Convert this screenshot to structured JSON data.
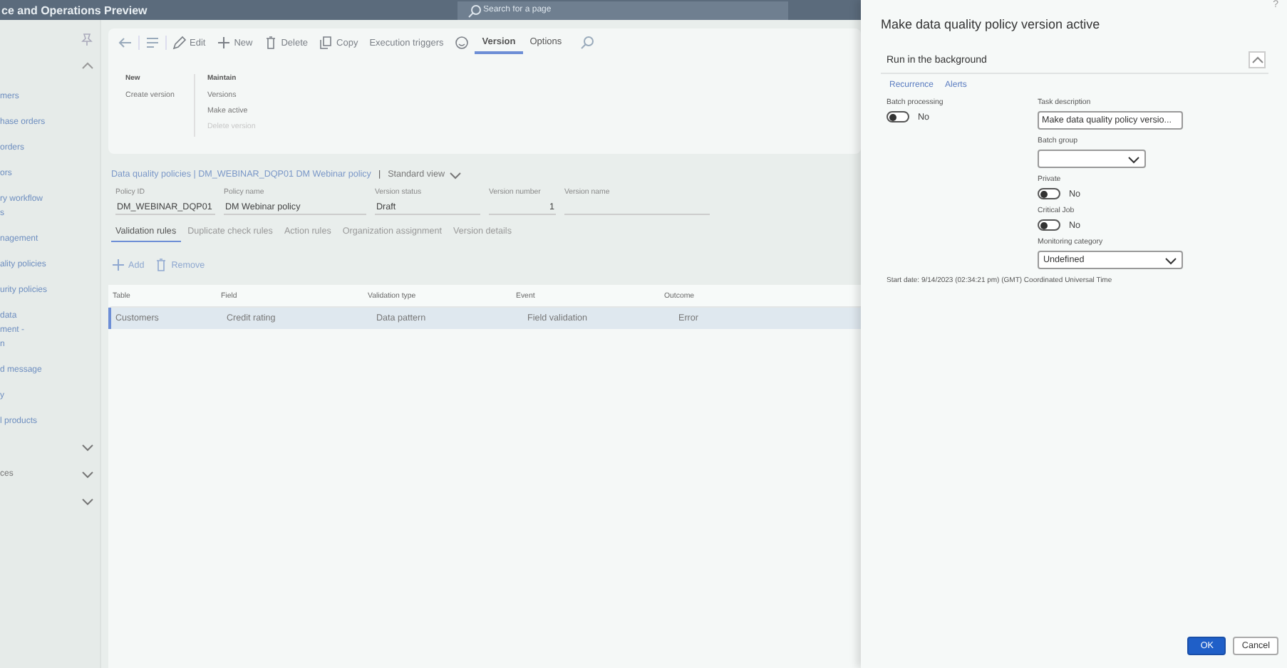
{
  "app_bar": {
    "title": "ce and Operations Preview",
    "search": {
      "placeholder": "Search for a page"
    }
  },
  "sidebar": {
    "items": [
      {
        "lines": [
          "mers"
        ]
      },
      {
        "lines": [
          "hase orders"
        ]
      },
      {
        "lines": [
          "orders"
        ]
      },
      {
        "lines": [
          "ors"
        ]
      },
      {
        "lines": [
          "ry workflow",
          "s"
        ]
      },
      {
        "lines": [
          "nagement"
        ]
      },
      {
        "lines": [
          "ality policies"
        ]
      },
      {
        "lines": [
          "urity policies"
        ]
      },
      {
        "lines": [
          "data",
          "ment -",
          "n"
        ]
      },
      {
        "lines": [
          "d message"
        ]
      },
      {
        "lines": [
          "y"
        ]
      },
      {
        "lines": [
          "l products"
        ]
      }
    ],
    "groups": [
      {
        "expanded": false
      },
      {
        "label": "ces",
        "expanded": false
      },
      {
        "expanded": false
      }
    ]
  },
  "action_pane": {
    "buttons": [
      {
        "kind": "back"
      },
      {
        "kind": "menu"
      },
      {
        "kind": "edit",
        "label": "Edit"
      },
      {
        "kind": "new",
        "label": "New"
      },
      {
        "kind": "delete",
        "label": "Delete"
      },
      {
        "kind": "copy",
        "label": "Copy"
      },
      {
        "kind": "text",
        "label": "Execution triggers"
      },
      {
        "kind": "smiley"
      }
    ],
    "tabs": [
      {
        "label": "Version",
        "selected": true
      },
      {
        "label": "Options",
        "selected": false
      }
    ],
    "groups": [
      {
        "title": "New",
        "items": [
          {
            "label": "Create version",
            "disabled": false
          }
        ]
      },
      {
        "title": "Maintain",
        "items": [
          {
            "label": "Versions",
            "disabled": false
          },
          {
            "label": "Make active",
            "disabled": false
          },
          {
            "label": "Delete version",
            "disabled": true
          }
        ]
      }
    ]
  },
  "breadcrumb": {
    "path": "Data quality policies | DM_WEBINAR_DQP01 DM Webinar policy",
    "separator": "|",
    "view": "Standard view"
  },
  "fields": [
    {
      "label": "Policy ID",
      "value": "DM_WEBINAR_DQP01",
      "kind": "text"
    },
    {
      "label": "Policy name",
      "value": "DM Webinar policy",
      "kind": "text"
    },
    {
      "label": "Version status",
      "value": "Draft",
      "kind": "text"
    },
    {
      "label": "Version number",
      "value": "1",
      "kind": "number"
    },
    {
      "label": "Version name",
      "kind": "text"
    }
  ],
  "tabs": [
    {
      "label": "Validation rules",
      "selected": true
    },
    {
      "label": "Duplicate check rules",
      "selected": false
    },
    {
      "label": "Action rules",
      "selected": false
    },
    {
      "label": "Organization assignment",
      "selected": false
    },
    {
      "label": "Version details",
      "selected": false
    }
  ],
  "grid_actions": [
    {
      "kind": "add",
      "label": "Add"
    },
    {
      "kind": "remove",
      "label": "Remove"
    }
  ],
  "table": {
    "columns": [
      "Table",
      "Field",
      "Validation type",
      "Event",
      "Outcome"
    ],
    "rows": [
      {
        "cells": [
          "Customers",
          "Credit rating",
          "Data pattern",
          "Field validation",
          "Error"
        ],
        "selected": true
      }
    ]
  },
  "dialog": {
    "title": "Make data quality policy version active",
    "help": "?",
    "section": {
      "title": "Run in the background",
      "expanded": true,
      "links": [
        "Recurrence",
        "Alerts"
      ],
      "left": [
        {
          "kind": "toggle",
          "label": "Batch processing",
          "on": false,
          "state_text": "No"
        }
      ],
      "right": [
        {
          "kind": "text",
          "label": "Task description",
          "value": "Make data quality policy versio..."
        },
        {
          "kind": "select",
          "label": "Batch group"
        },
        {
          "kind": "toggle",
          "label": "Private",
          "on": false,
          "state_text": "No"
        },
        {
          "kind": "toggle",
          "label": "Critical Job",
          "on": false,
          "state_text": "No"
        },
        {
          "kind": "select",
          "label": "Monitoring category",
          "value": "Undefined"
        }
      ],
      "note": "Start date: 9/14/2023 (02:34:21 pm) (GMT) Coordinated Universal Time"
    },
    "buttons": [
      {
        "label": "OK",
        "primary": true
      },
      {
        "label": "Cancel",
        "primary": false
      }
    ]
  }
}
